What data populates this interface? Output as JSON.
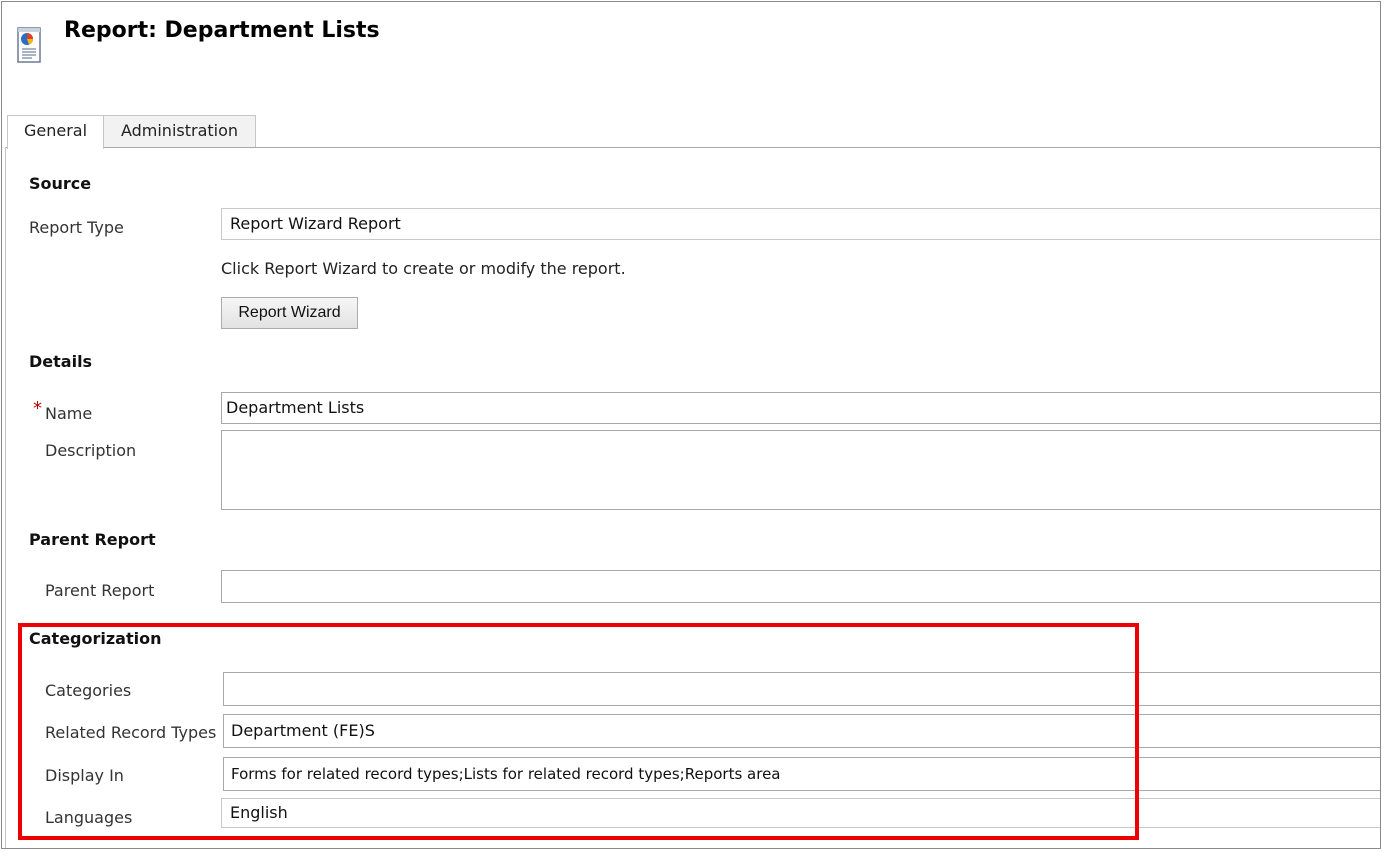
{
  "header": {
    "title": "Report: Department Lists"
  },
  "tabs": [
    {
      "label": "General",
      "active": true
    },
    {
      "label": "Administration",
      "active": false
    }
  ],
  "sections": {
    "source": {
      "title": "Source",
      "report_type_label": "Report Type",
      "report_type_value": "Report Wizard Report",
      "note": "Click Report Wizard to create or modify the report.",
      "wizard_button": "Report Wizard"
    },
    "details": {
      "title": "Details",
      "required_mark": "*",
      "name_label": "Name",
      "name_value": "Department Lists",
      "description_label": "Description",
      "description_value": ""
    },
    "parent": {
      "title": "Parent Report",
      "parent_label": "Parent Report",
      "parent_value": ""
    },
    "categorization": {
      "title": "Categorization",
      "categories_label": "Categories",
      "categories_value": "",
      "related_label": "Related Record Types",
      "related_value": "Department (FE)S",
      "display_label": "Display In",
      "display_value": "Forms for related record types;Lists for related record types;Reports area",
      "languages_label": "Languages",
      "languages_value": "English"
    }
  },
  "colors": {
    "highlight": "#ee0000",
    "required": "#c00000"
  }
}
